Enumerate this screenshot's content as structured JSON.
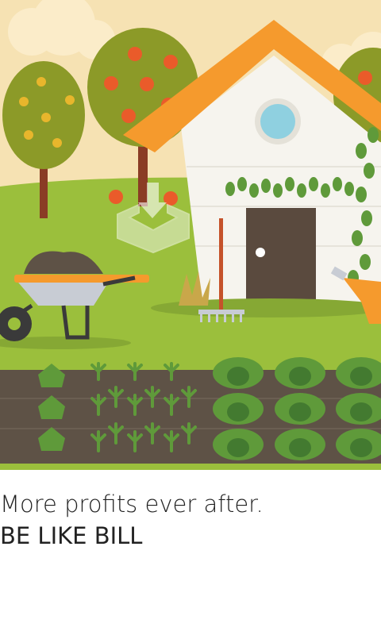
{
  "ad": {
    "headline": "More profits ever after.",
    "tagline": "BE LIKE BILL"
  },
  "icons": {
    "download": "download-icon"
  },
  "colors": {
    "sky": "#f6e2b3",
    "grass": "#9bbf3c",
    "soil": "#5e5246",
    "roof": "#f59a2d",
    "house": "#f6f4ee",
    "door": "#5a4a3e"
  }
}
